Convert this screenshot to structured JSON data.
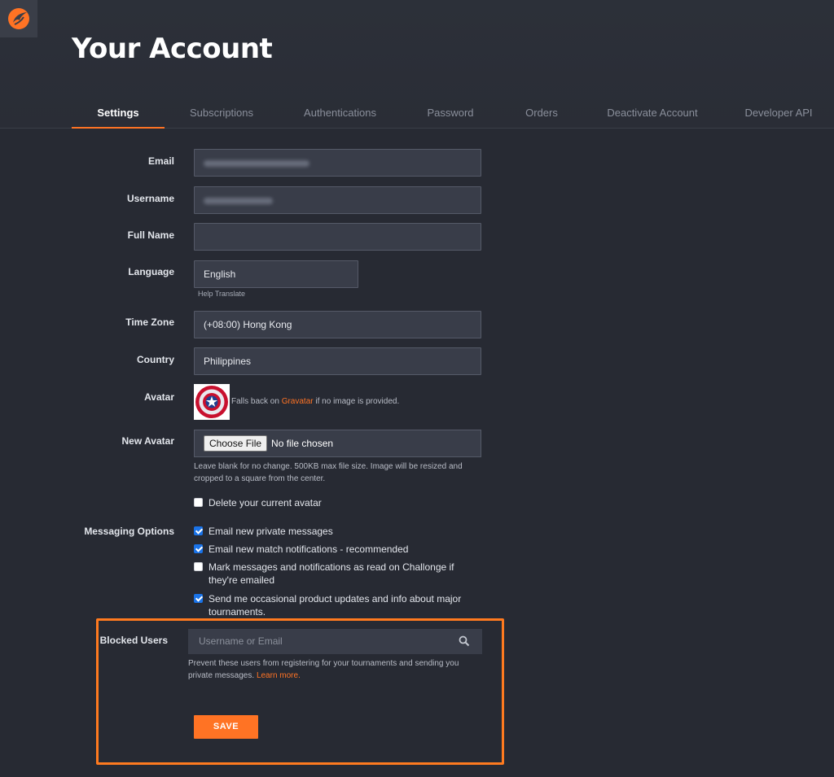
{
  "header": {
    "title": "Your Account",
    "logo_icon": "challonge-logo-icon",
    "accent_color": "#ff7324"
  },
  "tabs": [
    {
      "label": "Settings",
      "active": true
    },
    {
      "label": "Subscriptions",
      "active": false
    },
    {
      "label": "Authentications",
      "active": false
    },
    {
      "label": "Password",
      "active": false
    },
    {
      "label": "Orders",
      "active": false
    },
    {
      "label": "Deactivate Account",
      "active": false
    },
    {
      "label": "Developer API",
      "active": false
    }
  ],
  "form": {
    "email": {
      "label": "Email"
    },
    "username": {
      "label": "Username"
    },
    "full_name": {
      "label": "Full Name",
      "value": ""
    },
    "language": {
      "label": "Language",
      "value": "English",
      "help": "Help Translate"
    },
    "time_zone": {
      "label": "Time Zone",
      "value": "(+08:00) Hong Kong"
    },
    "country": {
      "label": "Country",
      "value": "Philippines"
    },
    "avatar": {
      "label": "Avatar",
      "note_prefix": "Falls back on ",
      "note_link": "Gravatar",
      "note_suffix": " if no image is provided."
    },
    "new_avatar": {
      "label": "New Avatar",
      "button": "Choose File",
      "status": "No file chosen",
      "hint": "Leave blank for no change. 500KB max file size. Image will be resized and cropped to a square from the center.",
      "delete_label": "Delete your current avatar",
      "delete_checked": false
    },
    "messaging": {
      "label": "Messaging Options",
      "options": [
        {
          "label": "Email new private messages",
          "checked": true
        },
        {
          "label": "Email new match notifications - recommended",
          "checked": true
        },
        {
          "label": "Mark messages and notifications as read on Challonge if they're emailed",
          "checked": false
        },
        {
          "label": "Send me occasional product updates and info about major tournaments.",
          "checked": true
        }
      ]
    },
    "blocked_users": {
      "label": "Blocked Users",
      "placeholder": "Username or Email",
      "hint": "Prevent these users from registering for your tournaments and sending you private messages.",
      "learn_more": "Learn more."
    },
    "save_label": "SAVE"
  }
}
